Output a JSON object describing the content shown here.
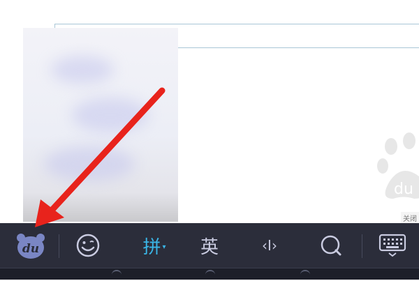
{
  "page": {
    "close_ad_label": "关闭",
    "watermark_text": "du"
  },
  "toolbar": {
    "logo_text": "du",
    "emoji_icon": "smiley-icon",
    "pinyin_label": "拼",
    "pinyin_caret": "▾",
    "english_label": "英",
    "cursor_label": "‹I›",
    "search_icon": "search-icon",
    "keyboard_icon": "keyboard-icon"
  },
  "annotation": {
    "arrow_color": "#e8231c"
  },
  "colors": {
    "toolbar_bg": "#2b2d3a",
    "active_blue": "#3ab5e6",
    "icon_gray": "#c9cbe0",
    "logo_bg": "#7a86c4"
  }
}
